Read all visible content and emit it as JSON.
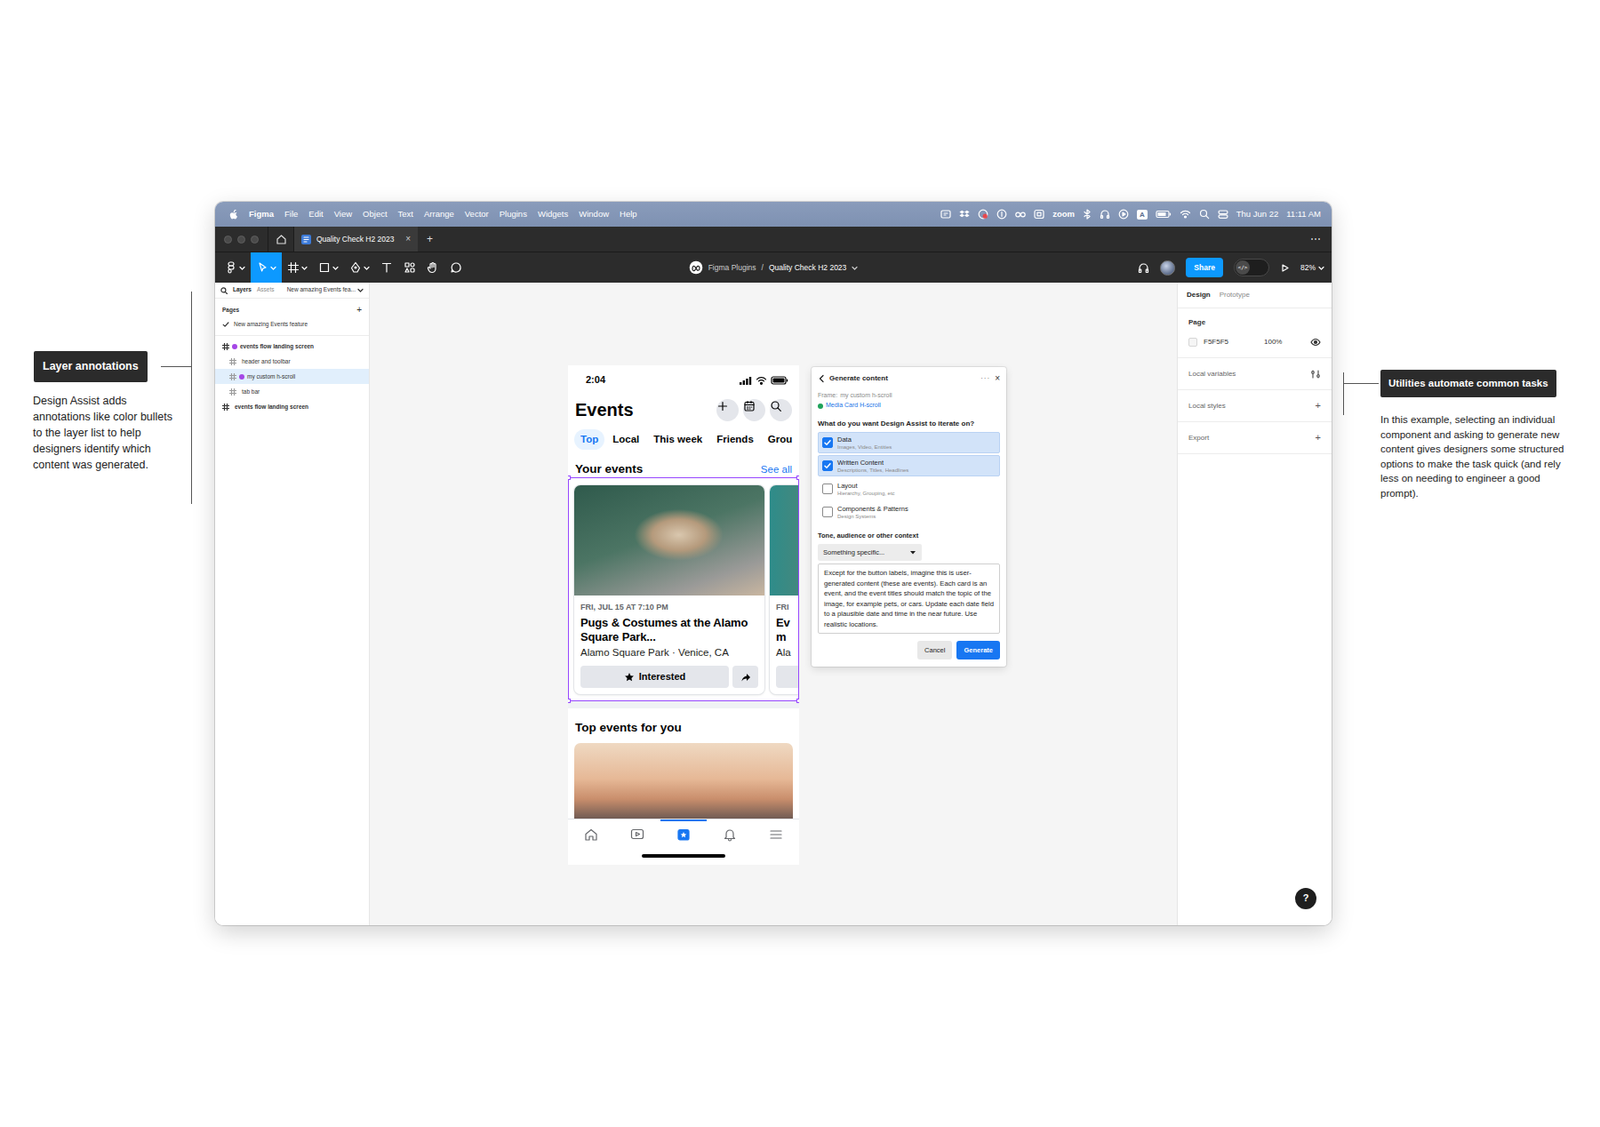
{
  "annotations": [
    {
      "label": "Layer annotations",
      "text": "Design Assist adds annotations like color bullets to the layer list to help designers identify which content was generated."
    },
    {
      "label": "Utilities automate common tasks",
      "text": "In this example, selecting an individual component and asking to generate new content gives designers some structured options to make the task quick (and rely less on needing to engineer a good prompt)."
    }
  ],
  "menu_bar": {
    "app": "Figma",
    "items": [
      "File",
      "Edit",
      "View",
      "Object",
      "Text",
      "Arrange",
      "Vector",
      "Plugins",
      "Widgets",
      "Window",
      "Help"
    ],
    "status": [
      {
        "kind": "plugin"
      },
      {
        "kind": "dropbox"
      },
      {
        "kind": "recorder"
      },
      {
        "kind": "password"
      },
      {
        "kind": "glasses"
      },
      {
        "kind": "screen"
      },
      {
        "kind": "text",
        "label": "zoom"
      },
      {
        "kind": "bluetooth"
      },
      {
        "kind": "headphones"
      },
      {
        "kind": "media"
      },
      {
        "kind": "input",
        "label": "A"
      },
      {
        "kind": "battery"
      },
      {
        "kind": "wifi"
      },
      {
        "kind": "search"
      },
      {
        "kind": "control-center"
      }
    ],
    "date": "Thu Jun 22",
    "time": "11:11 AM"
  },
  "tab_bar": {
    "tabs": [
      {
        "label": "Quality Check H2 2023",
        "close": "×",
        "selected": true
      }
    ],
    "new_tab": "+",
    "more": "⋯"
  },
  "toolbar": {
    "tools": [
      {
        "kind": "main-menu",
        "selected": false,
        "menu": true
      },
      {
        "kind": "move",
        "selected": true,
        "menu": true
      },
      {
        "kind": "frame",
        "selected": false,
        "menu": true
      },
      {
        "kind": "shape",
        "selected": false,
        "menu": true
      },
      {
        "kind": "pen",
        "selected": false,
        "menu": true
      },
      {
        "kind": "text",
        "selected": false,
        "menu": false
      },
      {
        "kind": "resources",
        "selected": false,
        "menu": false
      },
      {
        "kind": "hand",
        "selected": false,
        "menu": false
      },
      {
        "kind": "comment",
        "selected": false,
        "menu": false
      }
    ],
    "team": "Figma Plugins",
    "separator": "/",
    "file": "Quality Check H2 2023",
    "share": "Share",
    "dev_mode": {
      "label": "</>",
      "on": false
    },
    "zoom": "82%"
  },
  "layers_panel": {
    "tabs": [
      {
        "label": "Layers",
        "selected": true
      },
      {
        "label": "Assets",
        "selected": false
      }
    ],
    "page_picker": "New amazing Events fea...",
    "pages_title": "Pages",
    "add": "+",
    "pages": [
      {
        "name": "New amazing Events feature",
        "current": true
      }
    ],
    "layers": [
      {
        "name": "events flow landing screen",
        "annotated": true,
        "selected": false,
        "children": [
          {
            "name": "header and toolbar",
            "annotated": false,
            "selected": false
          },
          {
            "name": "my custom h-scroll",
            "annotated": true,
            "selected": true
          },
          {
            "name": "tab bar",
            "annotated": false,
            "selected": false
          }
        ]
      },
      {
        "name": "events flow landing screen",
        "annotated": false,
        "selected": false,
        "children": []
      }
    ]
  },
  "design_panel": {
    "tabs": [
      {
        "label": "Design",
        "selected": true
      },
      {
        "label": "Prototype",
        "selected": false
      }
    ],
    "page_title": "Page",
    "fill": "F5F5F5",
    "opacity": "100%",
    "visible": true,
    "sections": [
      {
        "label": "Local variables",
        "kind": "settings"
      },
      {
        "label": "Local styles",
        "kind": "add",
        "action": "+"
      },
      {
        "label": "Export",
        "kind": "add",
        "action": "+"
      }
    ],
    "help": "?"
  },
  "phone": {
    "time": "2:04",
    "title": "Events",
    "actions": [
      {
        "kind": "create"
      },
      {
        "kind": "calendar"
      },
      {
        "kind": "search"
      }
    ],
    "chips": [
      {
        "label": "Top",
        "selected": true
      },
      {
        "label": "Local",
        "selected": false
      },
      {
        "label": "This week",
        "selected": false
      },
      {
        "label": "Friends",
        "selected": false
      },
      {
        "label": "Grou",
        "selected": false
      }
    ],
    "your_events": {
      "title": "Your events",
      "link": "See all",
      "cards": [
        {
          "date": "FRI, JUL 15 AT 7:10 PM",
          "title_lines": [
            "Pugs & Costumes at the Alamo",
            "Square Park..."
          ],
          "location": "Alamo Square Park · Venice, CA",
          "button": "Interested"
        },
        {
          "date": "FRI",
          "title_lines": [
            "Ev",
            "m"
          ],
          "location": "Ala"
        }
      ]
    },
    "top_events": {
      "title": "Top events for you"
    },
    "tabs": [
      {
        "kind": "home",
        "selected": false
      },
      {
        "kind": "video",
        "selected": false
      },
      {
        "kind": "events",
        "selected": true
      },
      {
        "kind": "notifications",
        "selected": false
      },
      {
        "kind": "menu",
        "selected": false
      }
    ]
  },
  "plugin": {
    "title": "Generate content",
    "more": "···",
    "close": "×",
    "frame_label": "Frame:",
    "frame": "my custom h-scroll",
    "component": "Media Card H-scroll",
    "component_ok": true,
    "question": "What do you want Design Assist to iterate on?",
    "options": [
      {
        "label": "Data",
        "hint": "Images, Video, Entities",
        "checked": true
      },
      {
        "label": "Written Content",
        "hint": "Descriptions, Titles, Headlines",
        "checked": true
      },
      {
        "label": "Layout",
        "hint": "Hierarchy, Grouping, etc",
        "checked": false
      },
      {
        "label": "Components & Patterns",
        "hint": "Design Systems",
        "checked": false
      }
    ],
    "context_title": "Tone, audience or other context",
    "context_choice": "Something specific...",
    "prompt": "Except for the button labels, imagine this is user-generated content (these are events). Each card is an event, and the event titles should match the topic of the image, for example pets, or cars. Update each date field to a plausible date and time in the near future. Use realistic locations.",
    "buttons": [
      {
        "label": "Cancel",
        "kind": "secondary"
      },
      {
        "label": "Generate",
        "kind": "primary"
      }
    ]
  }
}
